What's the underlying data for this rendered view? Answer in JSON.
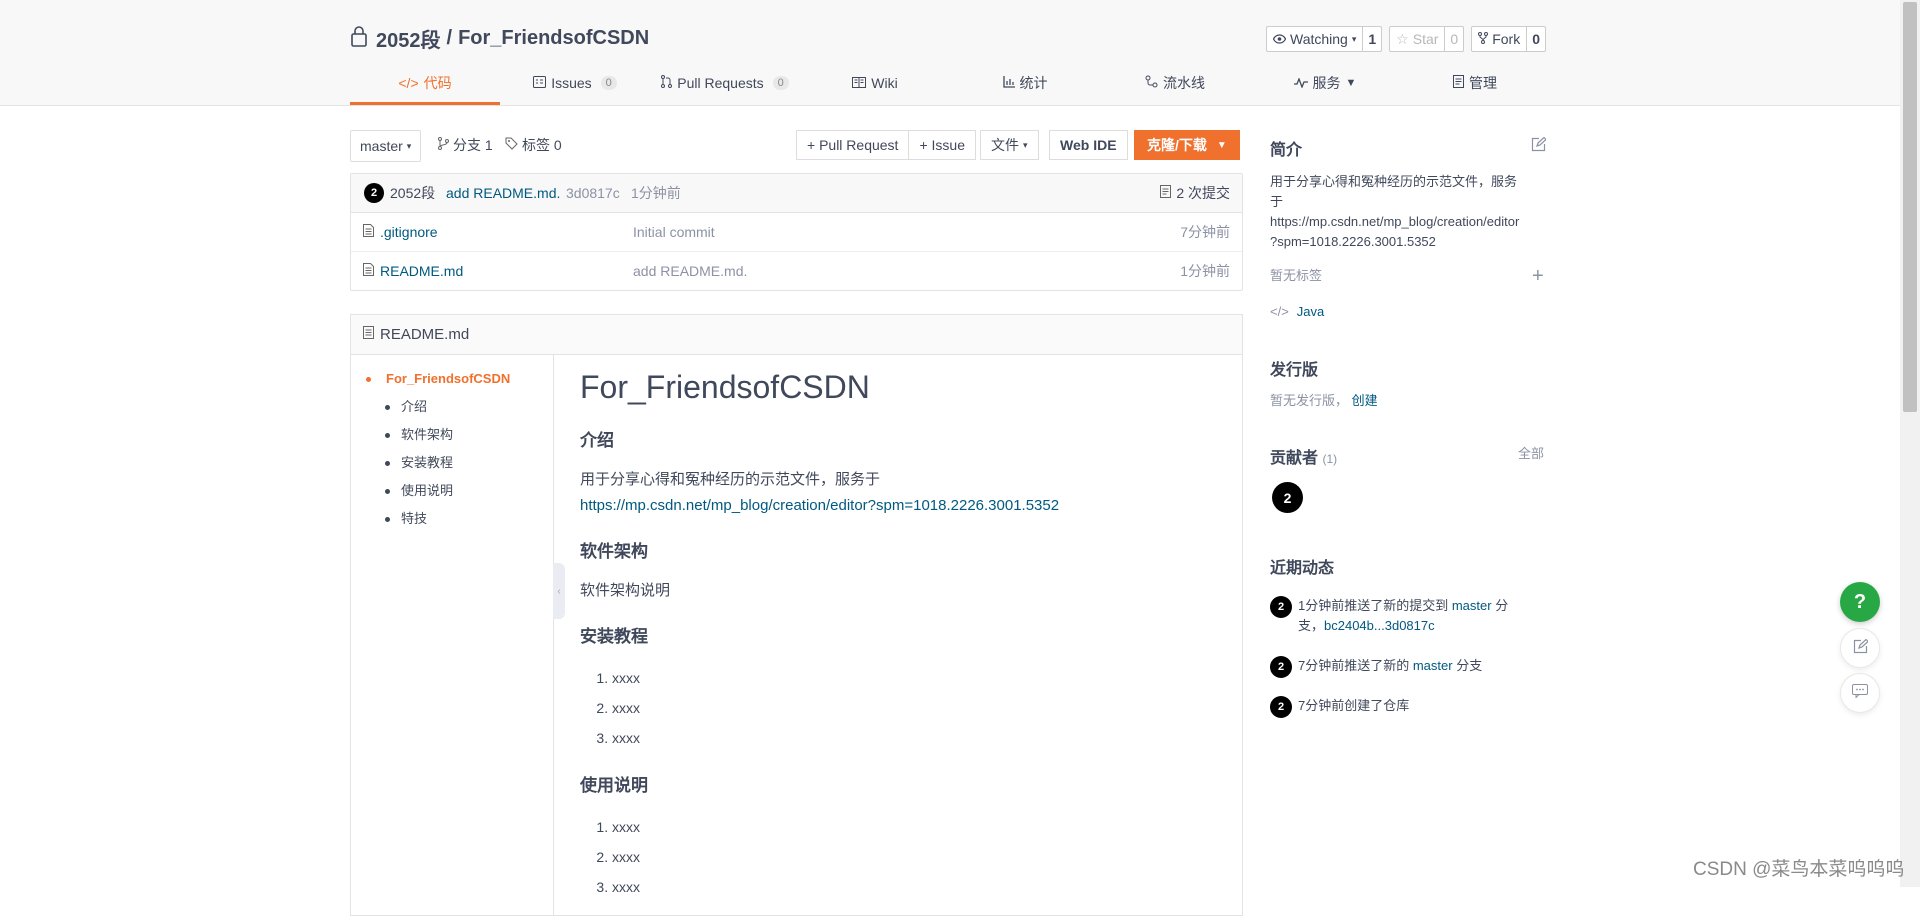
{
  "repo": {
    "owner": "2052段",
    "separator": "/",
    "name": "For_FriendsofCSDN"
  },
  "header_buttons": {
    "watching_label": "Watching",
    "watching_count": "1",
    "star_label": "Star",
    "star_count": "0",
    "fork_label": "Fork",
    "fork_count": "0"
  },
  "tabs": [
    {
      "label": "代码",
      "icon": "code-icon",
      "active": true
    },
    {
      "label": "Issues",
      "badge": "0",
      "icon": "issues-icon"
    },
    {
      "label": "Pull Requests",
      "badge": "0",
      "icon": "pull-request-icon"
    },
    {
      "label": "Wiki",
      "icon": "wiki-icon"
    },
    {
      "label": "统计",
      "icon": "chart-icon"
    },
    {
      "label": "流水线",
      "icon": "pipeline-icon"
    },
    {
      "label": "服务",
      "icon": "service-icon"
    },
    {
      "label": "管理",
      "icon": "manage-icon"
    }
  ],
  "toolbar": {
    "branch": "master",
    "branches_label": "分支 1",
    "tags_label": "标签 0",
    "pull_request_btn": "+ Pull Request",
    "issue_btn": "+ Issue",
    "file_btn": "文件",
    "web_ide_btn": "Web IDE",
    "clone_btn": "克隆/下载"
  },
  "latest_commit": {
    "avatar": "2",
    "author": "2052段",
    "message": "add README.md.",
    "hash": "3d0817c",
    "time": "1分钟前",
    "commits_label": "2 次提交"
  },
  "files": [
    {
      "name": ".gitignore",
      "message": "Initial commit",
      "time": "7分钟前"
    },
    {
      "name": "README.md",
      "message": "add README.md.",
      "time": "1分钟前"
    }
  ],
  "readme": {
    "file_label": "README.md",
    "toc_top": "For_FriendsofCSDN",
    "toc": [
      "介绍",
      "软件架构",
      "安装教程",
      "使用说明",
      "特技"
    ],
    "h1": "For_FriendsofCSDN",
    "intro_heading": "介绍",
    "intro_text": "用于分享心得和冤种经历的示范文件，服务于",
    "intro_link": "https://mp.csdn.net/mp_blog/creation/editor?spm=1018.2226.3001.5352",
    "arch_heading": "软件架构",
    "arch_text": "软件架构说明",
    "install_heading": "安装教程",
    "install_items": [
      "xxxx",
      "xxxx",
      "xxxx"
    ],
    "usage_heading": "使用说明",
    "usage_items": [
      "xxxx",
      "xxxx",
      "xxxx"
    ]
  },
  "sidebar": {
    "intro_title": "简介",
    "intro_text_1": "用于分享心得和冤种经历的示范文件，服务",
    "intro_text_2": "于",
    "intro_url_1": "https://mp.csdn.net/mp_blog/creation/editor",
    "intro_url_2": "?spm=1018.2226.3001.5352",
    "no_tags": "暂无标签",
    "language": "Java",
    "releases_title": "发行版",
    "no_releases": "暂无发行版，",
    "create_link": "创建",
    "contributors_title": "贡献者",
    "contributors_count": "(1)",
    "all_link": "全部",
    "contributor_avatar": "2",
    "activity_title": "近期动态",
    "activities": [
      {
        "avatar": "2",
        "text_1": "1分钟前推送了新的提交到 ",
        "branch": "master",
        "text_2": " 分",
        "line2_text": "支，",
        "range": "bc2404b...3d0817c"
      },
      {
        "avatar": "2",
        "text_1": "7分钟前推送了新的 ",
        "branch": "master",
        "text_2": " 分支"
      },
      {
        "avatar": "2",
        "text_1": "7分钟前创建了仓库"
      }
    ]
  },
  "floating": {
    "help": "?"
  },
  "watermark": "CSDN @菜鸟本菜呜呜呜",
  "colors": {
    "accent": "#f0702e",
    "link": "#005980",
    "help_green": "#27a844"
  }
}
